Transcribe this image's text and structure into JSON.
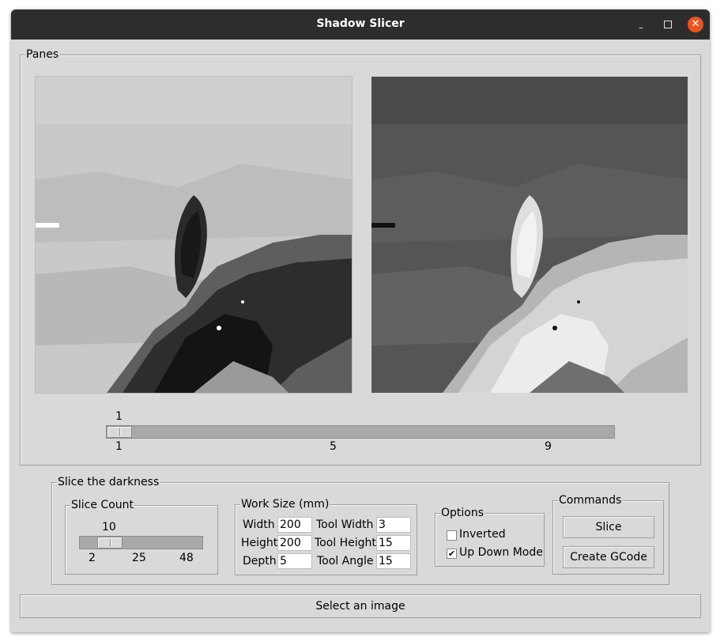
{
  "window": {
    "title": "Shadow Slicer"
  },
  "panes": {
    "legend": "Panes",
    "left_image": "grayscale-darkness-slice-image",
    "right_image": "grayscale-inverted-preview-image",
    "slider": {
      "value_label": "1",
      "value": 1,
      "min": 1,
      "max": 9,
      "ticks": [
        "1",
        "5",
        "9"
      ]
    }
  },
  "slice_the_darkness": {
    "legend": "Slice the darkness",
    "slice_count": {
      "legend": "Slice Count",
      "value_label": "10",
      "value": 10,
      "min": 2,
      "max": 48,
      "ticks": [
        "2",
        "25",
        "48"
      ]
    },
    "work_size": {
      "legend": "Work Size (mm)",
      "width_label": "Width",
      "width_value": "200",
      "height_label": "Height",
      "height_value": "200",
      "depth_label": "Depth",
      "depth_value": "5",
      "tool_width_label": "Tool Width",
      "tool_width_value": "3",
      "tool_height_label": "Tool Height",
      "tool_height_value": "15",
      "tool_angle_label": "Tool Angle",
      "tool_angle_value": "15"
    },
    "options": {
      "legend": "Options",
      "inverted_label": "Inverted",
      "inverted_checked": false,
      "up_down_label": "Up Down Mode",
      "up_down_checked": true
    },
    "commands": {
      "legend": "Commands",
      "slice_label": "Slice",
      "gcode_label": "Create GCode"
    }
  },
  "status": {
    "button_label": "Select an image"
  },
  "colors": {
    "titlebar": "#2d2d2d",
    "close": "#e95420",
    "window_bg": "#d9d9d9"
  }
}
